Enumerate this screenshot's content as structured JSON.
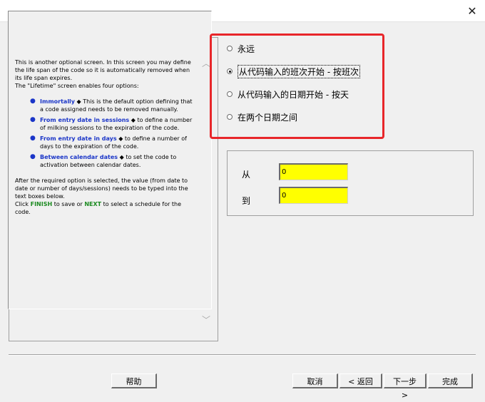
{
  "window": {
    "close_glyph": "✕"
  },
  "help": {
    "intro": "This is another optional screen. In this screen you may define the life span of the code so it is automatically removed when its life span expires.",
    "intro2": "The \"Lifetime\" screen enables four options:",
    "items": [
      {
        "keyword": "Immortally",
        "sep": " ◆ ",
        "text": "This is the default option defining that a code assigned needs to be removed manually."
      },
      {
        "keyword": "From entry date in sessions",
        "sep": " ◆ ",
        "text": "to define a number of milking sessions to the expiration of the code."
      },
      {
        "keyword": "From entry date in days",
        "sep": " ◆ ",
        "text": "to define a number of days to the expiration of the code."
      },
      {
        "keyword": "Between calendar dates",
        "sep": " ◆ ",
        "text": "to set the code to activation between calendar dates."
      }
    ],
    "outro": "After the required option is selected, the value (from date to date or number of days/sessions) needs to be typed into the text boxes below.",
    "outro2_pre": "Click ",
    "finish_kw": "FINISH",
    "outro2_mid": " to save or ",
    "next_kw": "NEXT",
    "outro2_post": " to select a schedule for the code.",
    "bullet_glyph": "●",
    "scroll_up_glyph": "︿",
    "scroll_down_glyph": "﹀"
  },
  "options": {
    "items": [
      "永远",
      "从代码输入的班次开始 - 按班次",
      "从代码输入的日期开始 - 按天",
      "在两个日期之间"
    ],
    "selected_index": 1
  },
  "range": {
    "from_label": "从",
    "to_label": "到",
    "from_value": "0",
    "to_value": "0"
  },
  "buttons": {
    "help": "帮助",
    "cancel": "取消",
    "back": "< 返回",
    "next": "下一步 >",
    "finish": "完成"
  },
  "colors": {
    "highlight": "#e8262a",
    "input_bg": "#ffff00",
    "keyword_blue": "#1a35c8",
    "keyword_green": "#1b8a20"
  }
}
